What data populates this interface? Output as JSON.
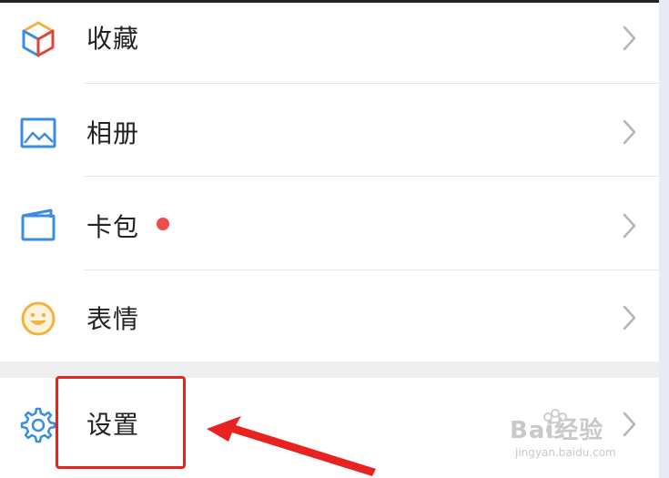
{
  "menu": {
    "items": [
      {
        "label": "收藏",
        "icon": "cube-favorites-icon"
      },
      {
        "label": "相册",
        "icon": "picture-album-icon"
      },
      {
        "label": "卡包",
        "icon": "card-wallet-icon",
        "badge_color": "#f04a4a"
      },
      {
        "label": "表情",
        "icon": "smiley-icon"
      }
    ],
    "settings": {
      "label": "设置",
      "icon": "gear-icon"
    }
  },
  "watermark": {
    "main": "Bai经验",
    "sub": "jingyan.baidu.com"
  },
  "colors": {
    "highlight": "#e8221f",
    "badge": "#f04a4a",
    "icon_blue": "#3a8de0"
  }
}
